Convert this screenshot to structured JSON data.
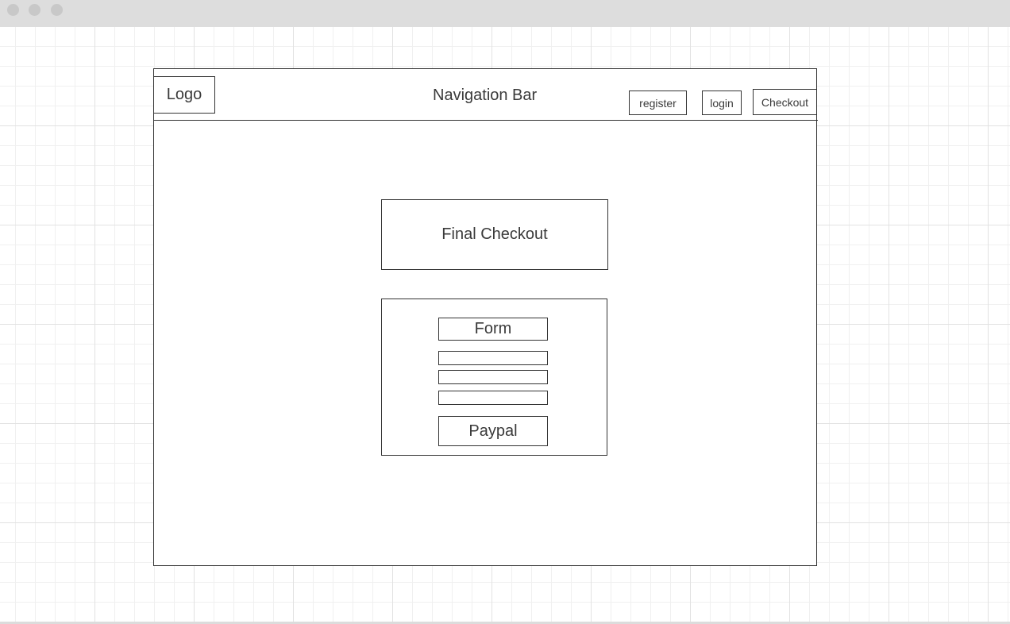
{
  "window": {
    "controls": [
      "close-dot",
      "minimize-dot",
      "zoom-dot"
    ]
  },
  "navbar": {
    "logo": "Logo",
    "title": "Navigation Bar",
    "links": {
      "register": "register",
      "login": "login",
      "checkout": "Checkout"
    }
  },
  "main": {
    "heading": "Final Checkout",
    "form": {
      "title": "Form",
      "fields": [
        "",
        "",
        ""
      ],
      "paypal_button": "Paypal"
    }
  }
}
